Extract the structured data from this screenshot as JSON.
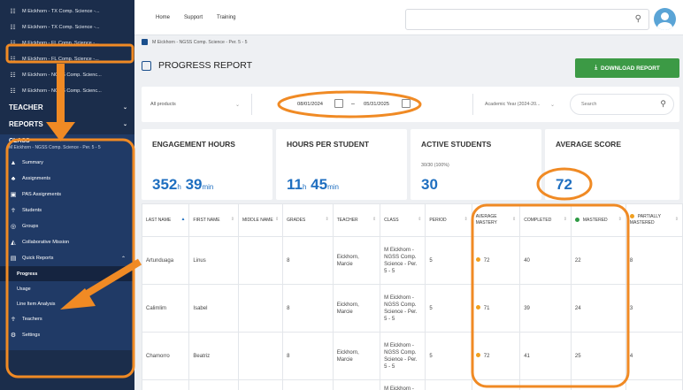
{
  "sidebar": {
    "classes": [
      {
        "label": "M Eickhorn - TX Comp. Science -..."
      },
      {
        "label": "M Eickhorn - TX Comp. Science -..."
      },
      {
        "label": "M Eickhorn - FL Comp. Science -..."
      },
      {
        "label": "M Eickhorn - FL Comp. Science -..."
      },
      {
        "label": "M Eickhorn - NGSS Comp. Scienc..."
      },
      {
        "label": "M Eickhorn - NGSS Comp. Scienc..."
      }
    ],
    "teacher_label": "TEACHER",
    "reports_label": "REPORTS",
    "class_title": "CLASS",
    "class_subtitle": "M Eickhorn - NGSS Comp. Science - Per. 5 - 5",
    "nav": {
      "summary": "Summary",
      "assignments": "Assignments",
      "pas_assignments": "PAS Assignments",
      "students": "Students",
      "groups": "Groups",
      "collaborative_mission": "Collaborative Mission",
      "quick_reports": "Quick Reports",
      "progress": "Progress",
      "usage": "Usage",
      "line_item_analysis": "Line Item Analysis",
      "teachers": "Teachers",
      "settings": "Settings"
    }
  },
  "topbar": {
    "home": "Home",
    "support": "Support",
    "training": "Training"
  },
  "breadcrumb": "M Eickhorn - NGSS Comp. Science - Per. 5 - 5",
  "page_title": "PROGRESS REPORT",
  "download_label": "DOWNLOAD REPORT",
  "filters": {
    "products": "All products",
    "date_start": "08/01/2024",
    "date_separator": "–",
    "date_end": "05/31/2025",
    "academic_year": "Academic Year (2024-20...",
    "search_placeholder": "Search"
  },
  "stats": {
    "engagement": {
      "title": "ENGAGEMENT HOURS",
      "hours": "352",
      "h_unit": "h",
      "minutes": "39",
      "min_unit": "min"
    },
    "per_student": {
      "title": "HOURS PER STUDENT",
      "hours": "11",
      "h_unit": "h",
      "minutes": "45",
      "min_unit": "min"
    },
    "active": {
      "title": "ACTIVE STUDENTS",
      "detail": "30/30 (100%)",
      "value": "30"
    },
    "average": {
      "title": "AVERAGE SCORE",
      "value": "72"
    }
  },
  "table": {
    "headers": {
      "last_name": "LAST NAME",
      "first_name": "FIRST NAME",
      "middle_name": "MIDDLE NAME",
      "grades": "GRADES",
      "teacher": "TEACHER",
      "class": "CLASS",
      "period": "PERIOD",
      "average_mastery": "AVERAGE MASTERY",
      "completed": "COMPLETED",
      "mastered": "MASTERED",
      "partially_mastered": "PARTIALLY MASTERED"
    },
    "rows": [
      {
        "last": "Artunduaga",
        "first": "Linus",
        "middle": "",
        "grade": "8",
        "teacher": "Eickhorn, Marcie",
        "class": "M Eickhorn - NGSS Comp. Science - Per. 5 - 5",
        "period": "5",
        "mastery": "72",
        "completed": "40",
        "mastered": "22",
        "partial": "8"
      },
      {
        "last": "Calimlim",
        "first": "Isabel",
        "middle": "",
        "grade": "8",
        "teacher": "Eickhorn, Marcie",
        "class": "M Eickhorn - NGSS Comp. Science - Per. 5 - 5",
        "period": "5",
        "mastery": "71",
        "completed": "39",
        "mastered": "24",
        "partial": "3"
      },
      {
        "last": "Chamorro",
        "first": "Beatriz",
        "middle": "",
        "grade": "8",
        "teacher": "Eickhorn, Marcie",
        "class": "M Eickhorn - NGSS Comp. Science - Per. 5 - 5",
        "period": "5",
        "mastery": "72",
        "completed": "41",
        "mastered": "25",
        "partial": "4"
      },
      {
        "last": "",
        "first": "",
        "middle": "",
        "grade": "",
        "teacher": "",
        "class": "M Eickhorn -",
        "period": "",
        "mastery": "",
        "completed": "",
        "mastered": "",
        "partial": ""
      }
    ]
  },
  "colors": {
    "sidebar_bg": "#1b2d4b",
    "accent_blue": "#1f6fc0",
    "download_green": "#3c9a45",
    "mastery_orange": "#f0a020",
    "mastered_green": "#2e9a44",
    "annotation_orange": "#f08a24"
  },
  "icons": {
    "class_item": "users-icon",
    "search": "magnifier-icon",
    "calendar": "calendar-icon",
    "download": "download-icon"
  }
}
